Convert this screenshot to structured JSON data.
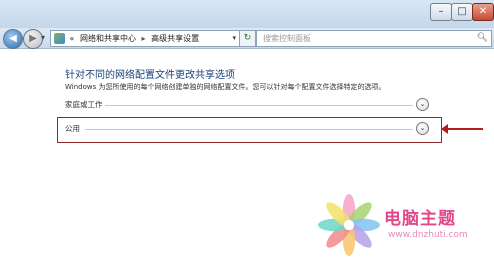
{
  "window": {
    "minimize_glyph": "–",
    "maximize_glyph": "□",
    "close_glyph": "✕"
  },
  "nav": {
    "back_glyph": "◀",
    "forward_glyph": "▶",
    "recent_glyph": "▾",
    "refresh_glyph": "↻"
  },
  "address": {
    "prefix": "«",
    "crumbs": [
      "网络和共享中心",
      "高级共享设置"
    ],
    "separator": "▸",
    "dropdown_glyph": "▾"
  },
  "search": {
    "placeholder": "搜索控制面板",
    "icon": "search-icon"
  },
  "page": {
    "title": "针对不同的网络配置文件更改共享选项",
    "description": "Windows 为您所使用的每个网络创建单独的网络配置文件。您可以针对每个配置文件选择特定的选项。",
    "profiles": [
      {
        "label": "家庭或工作",
        "expand_glyph": "⌄"
      },
      {
        "label": "公用",
        "expand_glyph": "⌄"
      }
    ]
  },
  "colors": {
    "accent": "#1a3f7a",
    "highlight": "#b31d1d"
  },
  "watermark": {
    "title": "电脑主题",
    "url": "www.dnzhuti.com"
  }
}
